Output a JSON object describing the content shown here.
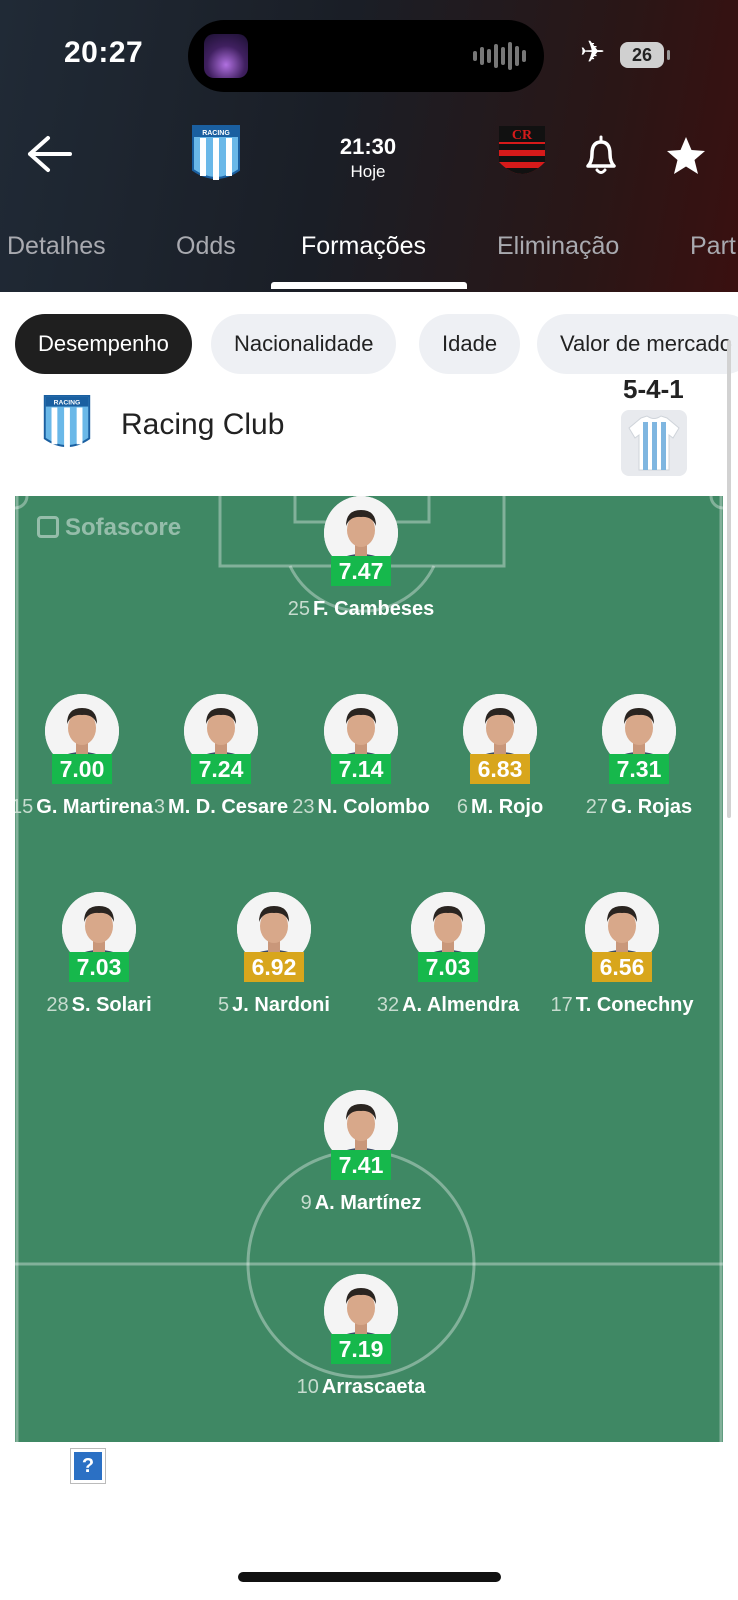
{
  "status_bar": {
    "time": "20:27",
    "battery": "26"
  },
  "match": {
    "kickoff_time": "21:30",
    "day": "Hoje",
    "home_team_logo_text": "RACING"
  },
  "tabs": [
    {
      "label": "Detalhes",
      "active": false
    },
    {
      "label": "Odds",
      "active": false
    },
    {
      "label": "Formações",
      "active": true
    },
    {
      "label": "Eliminação",
      "active": false
    },
    {
      "label": "Part",
      "active": false
    }
  ],
  "filters": [
    {
      "label": "Desempenho",
      "active": true
    },
    {
      "label": "Nacionalidade",
      "active": false
    },
    {
      "label": "Idade",
      "active": false
    },
    {
      "label": "Valor de mercado",
      "active": false
    }
  ],
  "team": {
    "name": "Racing Club",
    "formation": "5-4-1"
  },
  "watermark": "Sofascore",
  "colors": {
    "pitch": "#3f8864",
    "rating_green": "#16b84c",
    "rating_yellow": "#d8a61c"
  },
  "players": [
    {
      "number": "25",
      "name": "F. Cambeses",
      "rating": "7.47",
      "rating_color": "green"
    },
    {
      "number": "15",
      "name": "G. Martirena",
      "rating": "7.00",
      "rating_color": "green"
    },
    {
      "number": "3",
      "name": "M. D. Cesare",
      "rating": "7.24",
      "rating_color": "green"
    },
    {
      "number": "23",
      "name": "N. Colombo",
      "rating": "7.14",
      "rating_color": "green"
    },
    {
      "number": "6",
      "name": "M. Rojo",
      "rating": "6.83",
      "rating_color": "yellow"
    },
    {
      "number": "27",
      "name": "G. Rojas",
      "rating": "7.31",
      "rating_color": "green"
    },
    {
      "number": "28",
      "name": "S. Solari",
      "rating": "7.03",
      "rating_color": "green"
    },
    {
      "number": "5",
      "name": "J. Nardoni",
      "rating": "6.92",
      "rating_color": "yellow"
    },
    {
      "number": "32",
      "name": "A. Almendra",
      "rating": "7.03",
      "rating_color": "green"
    },
    {
      "number": "17",
      "name": "T. Conechny",
      "rating": "6.56",
      "rating_color": "yellow"
    },
    {
      "number": "9",
      "name": "A. Martínez",
      "rating": "7.41",
      "rating_color": "green"
    },
    {
      "number": "10",
      "name": "Arrascaeta",
      "rating": "7.19",
      "rating_color": "green"
    }
  ],
  "ad_placeholder": "?"
}
